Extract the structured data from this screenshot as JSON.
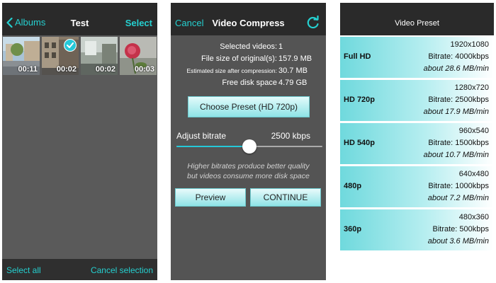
{
  "screen1": {
    "back_label": "Albums",
    "title": "Test",
    "select_label": "Select",
    "thumbnails": [
      {
        "duration": "00:11",
        "selected": false
      },
      {
        "duration": "00:02",
        "selected": true
      },
      {
        "duration": "00:02",
        "selected": false
      },
      {
        "duration": "00:03",
        "selected": false
      }
    ],
    "select_all_label": "Select all",
    "cancel_selection_label": "Cancel selection"
  },
  "screen2": {
    "cancel_label": "Cancel",
    "title": "Video Compress",
    "info": [
      {
        "label": "Selected videos:",
        "value": "1"
      },
      {
        "label": "File size of original(s):",
        "value": "157.9 MB"
      },
      {
        "label": "Estimated size after compression:",
        "value": "30.7 MB"
      },
      {
        "label": "Free disk space",
        "value": "4.79 GB"
      }
    ],
    "choose_preset_label": "Choose Preset (HD 720p)",
    "adjust_bitrate_label": "Adjust bitrate",
    "bitrate_value": "2500 kbps",
    "bitrate_slider_fraction": 0.5,
    "hint_line1": "Higher bitrates produce better quality",
    "hint_line2": "but videos consume more disk space",
    "preview_label": "Preview",
    "continue_label": "CONTINUE"
  },
  "screen3": {
    "title": "Video Preset",
    "presets": [
      {
        "name": "Full HD",
        "resolution": "1920x1080",
        "bitrate": "Bitrate: 4000kbps",
        "size": "about 28.6 MB/min"
      },
      {
        "name": "HD 720p",
        "resolution": "1280x720",
        "bitrate": "Bitrate: 2500kbps",
        "size": "about 17.9 MB/min"
      },
      {
        "name": "HD 540p",
        "resolution": "960x540",
        "bitrate": "Bitrate: 1500kbps",
        "size": "about 10.7 MB/min"
      },
      {
        "name": "480p",
        "resolution": "640x480",
        "bitrate": "Bitrate: 1000kbps",
        "size": "about 7.2 MB/min"
      },
      {
        "name": "360p",
        "resolution": "480x360",
        "bitrate": "Bitrate: 500kbps",
        "size": "about 3.6 MB/min"
      }
    ]
  },
  "colors": {
    "accent": "#25d0d0",
    "nav_bar": "#2a2a2a",
    "screen_bg": "#545454",
    "preset_cyan": "#6fd9dd"
  }
}
